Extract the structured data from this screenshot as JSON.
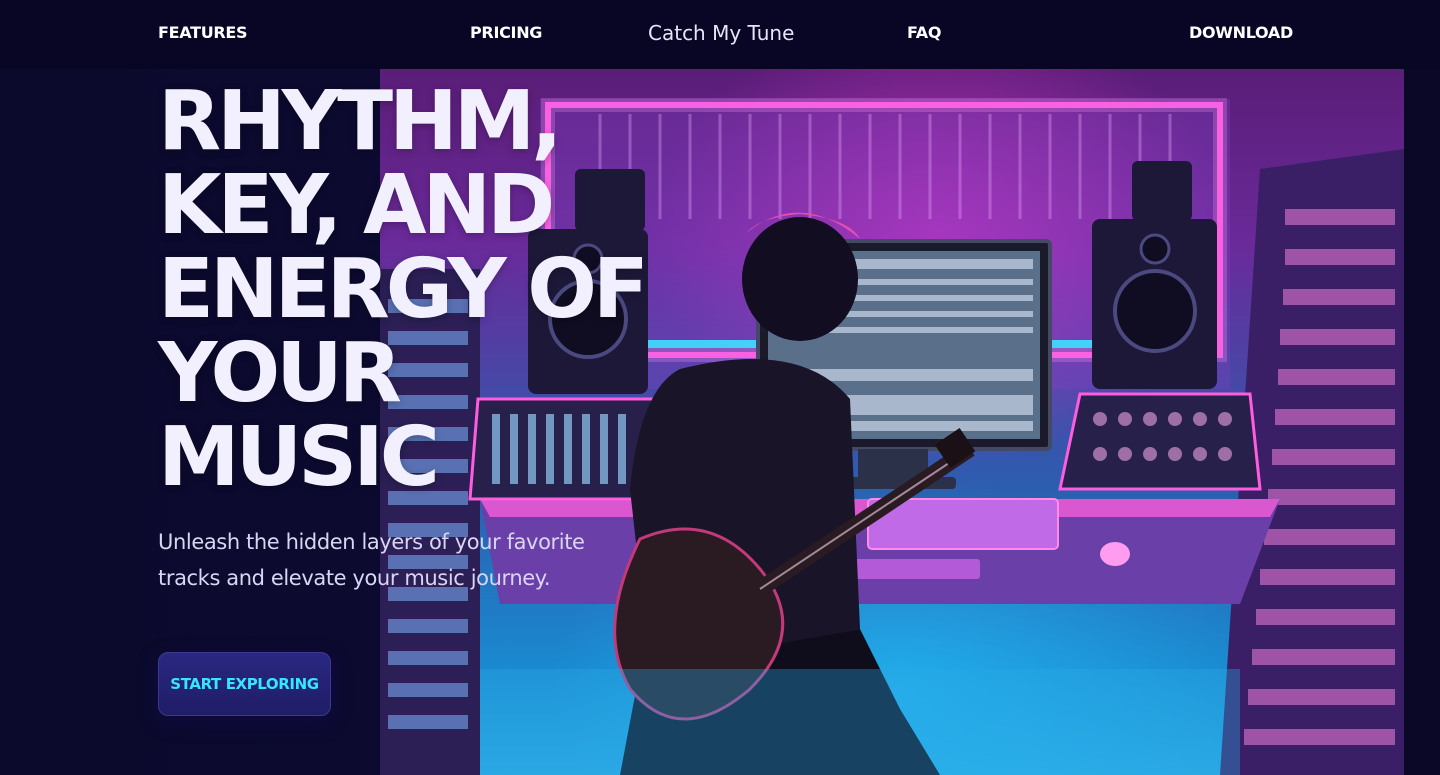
{
  "nav": {
    "features": "FEATURES",
    "pricing": "PRICING",
    "brand": "Catch My Tune",
    "faq": "FAQ",
    "download": "DOWNLOAD"
  },
  "hero": {
    "headline_lines": [
      "RHYTHM,",
      "KEY, AND",
      "ENERGY OF",
      "YOUR",
      "MUSIC"
    ],
    "subtitle": "Unleash the hidden layers of your favorite tracks and elevate your music journey.",
    "cta_label": "START EXPLORING"
  },
  "colors": {
    "background": "#0b0a2c",
    "nav_background": "#080624",
    "cta_text": "#35e6ff",
    "cta_background": "#23206f",
    "neon_pink": "#ff3fd8",
    "neon_cyan": "#2fd4ff"
  }
}
